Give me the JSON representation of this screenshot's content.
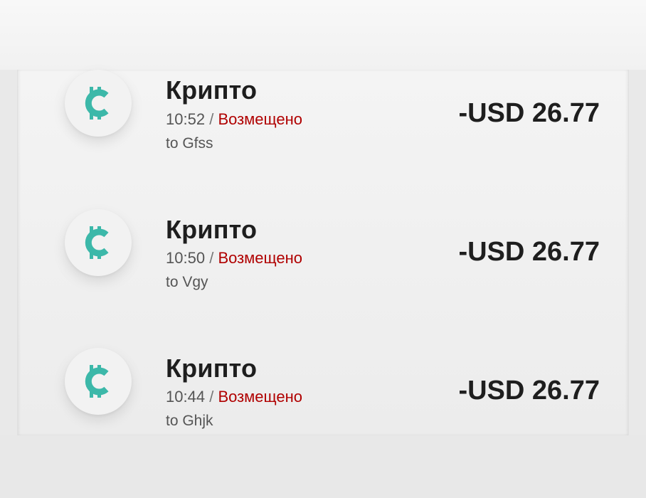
{
  "theme": {
    "icon_color": "#3cb8a9",
    "status_color": "#b00000",
    "text_color": "#1e1e1e"
  },
  "transactions": [
    {
      "icon": "crypto-coin-icon",
      "title": "Крипто",
      "time": "10:52",
      "separator": "/",
      "status": "Возмещено",
      "recipient": "to Gfss",
      "amount": "-USD 26.77"
    },
    {
      "icon": "crypto-coin-icon",
      "title": "Крипто",
      "time": "10:50",
      "separator": "/",
      "status": "Возмещено",
      "recipient": "to Vgy",
      "amount": "-USD 26.77"
    },
    {
      "icon": "crypto-coin-icon",
      "title": "Крипто",
      "time": "10:44",
      "separator": "/",
      "status": "Возмещено",
      "recipient": "to Ghjk",
      "amount": "-USD 26.77"
    }
  ]
}
